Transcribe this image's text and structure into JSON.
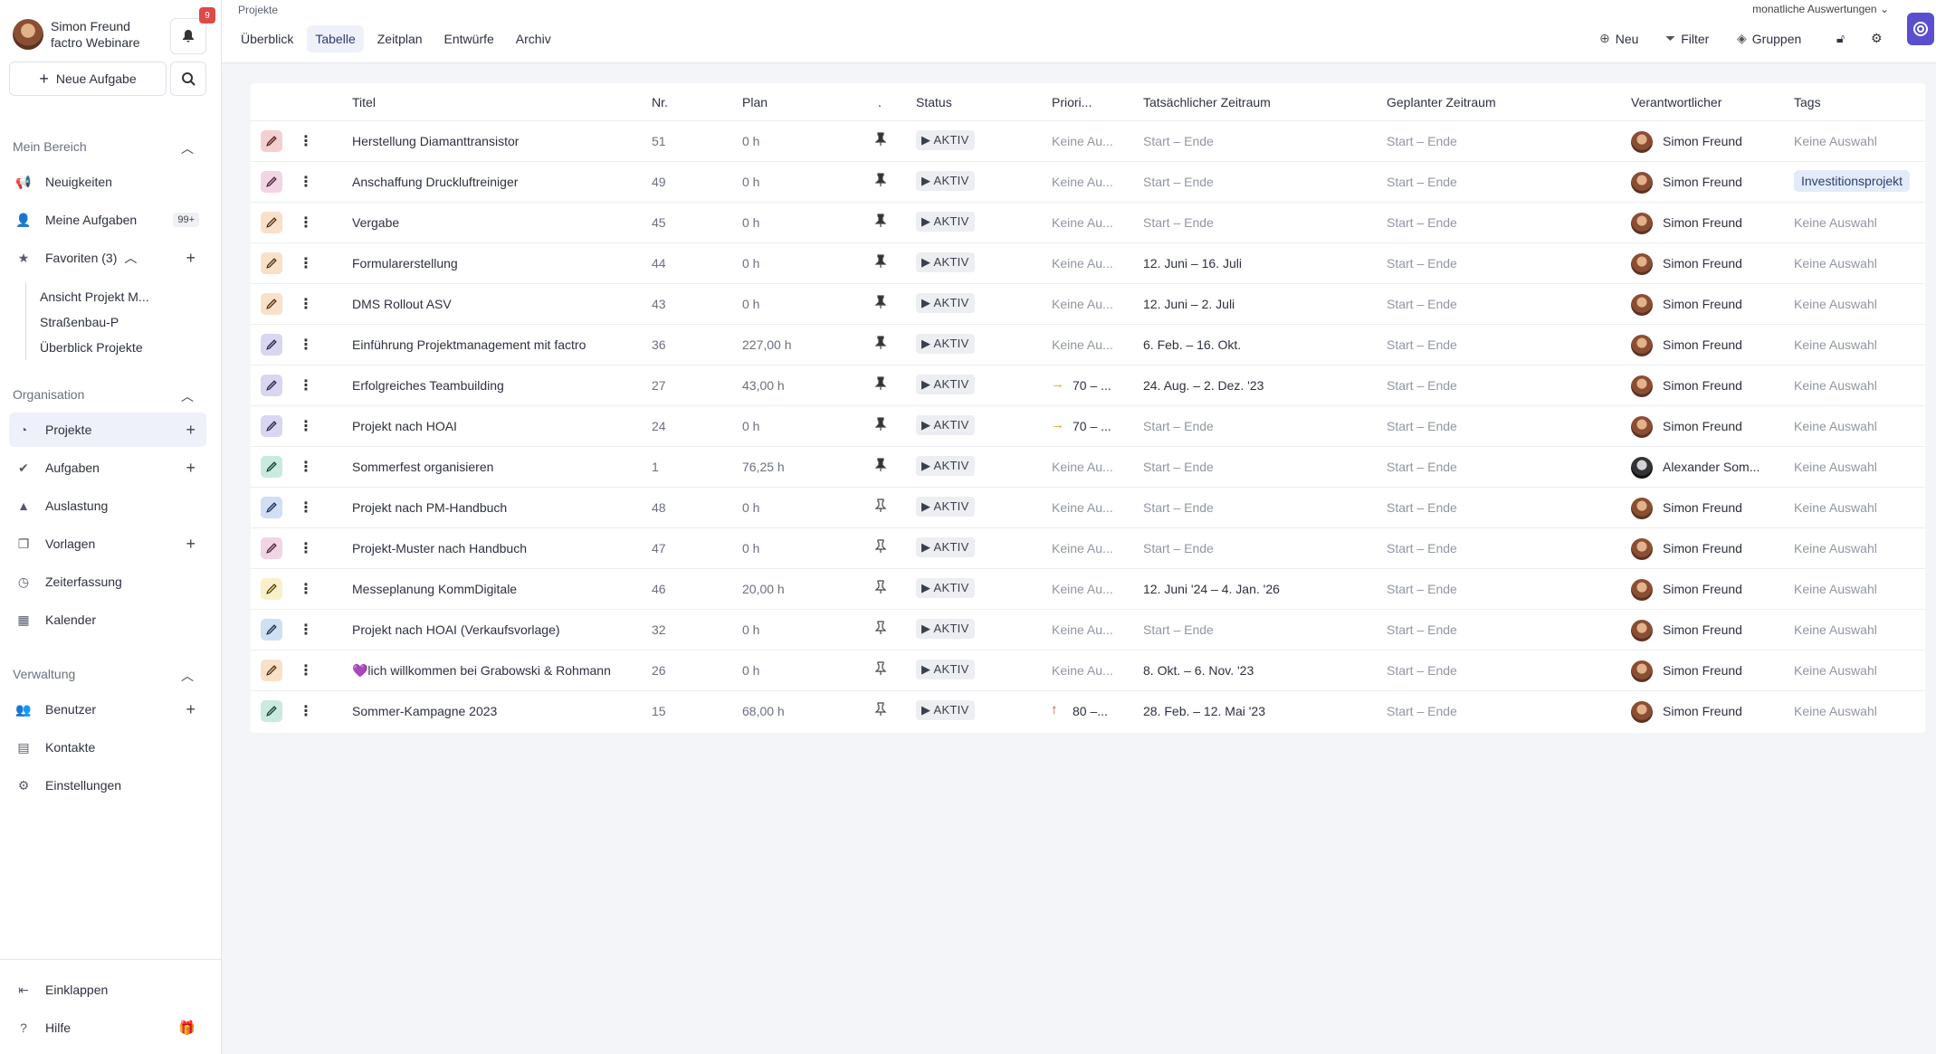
{
  "user": {
    "name": "Simon Freund",
    "org": "factro Webinare"
  },
  "notifications": {
    "count": "9"
  },
  "sidebar": {
    "new_task_label": "Neue Aufgabe",
    "sections": {
      "mein_bereich": "Mein Bereich",
      "organisation": "Organisation",
      "verwaltung": "Verwaltung"
    },
    "items": {
      "neuigkeiten": "Neuigkeiten",
      "meine_aufgaben": "Meine Aufgaben",
      "meine_aufgaben_badge": "99+",
      "favoriten": "Favoriten (3)",
      "projekte": "Projekte",
      "aufgaben": "Aufgaben",
      "auslastung": "Auslastung",
      "vorlagen": "Vorlagen",
      "zeiterfassung": "Zeiterfassung",
      "kalender": "Kalender",
      "benutzer": "Benutzer",
      "kontakte": "Kontakte",
      "einstellungen": "Einstellungen",
      "einklappen": "Einklappen",
      "hilfe": "Hilfe"
    },
    "favorites": [
      "Ansicht Projekt M...",
      "Straßenbau-P",
      "Überblick Projekte"
    ]
  },
  "header": {
    "breadcrumb": "Projekte",
    "tabs": [
      "Überblick",
      "Tabelle",
      "Zeitplan",
      "Entwürfe",
      "Archiv"
    ],
    "active_tab": "Tabelle",
    "report_label": "monatliche Auswertungen",
    "tools": {
      "neu": "Neu",
      "filter": "Filter",
      "gruppen": "Gruppen"
    }
  },
  "table": {
    "columns": {
      "titel": "Titel",
      "nr": "Nr.",
      "plan": "Plan",
      "pin": ".",
      "status": "Status",
      "prio": "Priori...",
      "tats": "Tatsächlicher Zeitraum",
      "gepl": "Geplanter Zeitraum",
      "verantw": "Verantwortlicher",
      "tags": "Tags"
    },
    "rows": [
      {
        "color": "#e2706f",
        "title": "Herstellung Diamanttransistor",
        "nr": "51",
        "plan": "0 h",
        "pinned": true,
        "status": "AKTIV",
        "prio": "Keine Au...",
        "prio_icon": "",
        "tats": "Start – Ende",
        "gepl": "Start – Ende",
        "owner": "Simon Freund",
        "tag": "Keine Auswahl",
        "tag_pill": false
      },
      {
        "color": "#d77fb0",
        "title": "Anschaffung Druckluftreiniger",
        "nr": "49",
        "plan": "0 h",
        "pinned": true,
        "status": "AKTIV",
        "prio": "Keine Au...",
        "prio_icon": "",
        "tats": "Start – Ende",
        "gepl": "Start – Ende",
        "owner": "Simon Freund",
        "tag": "Investitionsprojekt",
        "tag_pill": true
      },
      {
        "color": "#f0a35e",
        "title": "Vergabe",
        "nr": "45",
        "plan": "0 h",
        "pinned": true,
        "status": "AKTIV",
        "prio": "Keine Au...",
        "prio_icon": "",
        "tats": "Start – Ende",
        "gepl": "Start – Ende",
        "owner": "Simon Freund",
        "tag": "Keine Auswahl",
        "tag_pill": false
      },
      {
        "color": "#f0a35e",
        "title": "Formularerstellung",
        "nr": "44",
        "plan": "0 h",
        "pinned": true,
        "status": "AKTIV",
        "prio": "Keine Au...",
        "prio_icon": "",
        "tats": "12. Juni – 16. Juli",
        "gepl": "Start – Ende",
        "owner": "Simon Freund",
        "tag": "Keine Auswahl",
        "tag_pill": false
      },
      {
        "color": "#f0a35e",
        "title": "DMS Rollout ASV",
        "nr": "43",
        "plan": "0 h",
        "pinned": true,
        "status": "AKTIV",
        "prio": "Keine Au...",
        "prio_icon": "",
        "tats": "12. Juni – 2. Juli",
        "gepl": "Start – Ende",
        "owner": "Simon Freund",
        "tag": "Keine Auswahl",
        "tag_pill": false
      },
      {
        "color": "#8d84d9",
        "title": "Einführung Projektmanagement mit factro",
        "nr": "36",
        "plan": "227,00 h",
        "pinned": true,
        "status": "AKTIV",
        "prio": "Keine Au...",
        "prio_icon": "",
        "tats": "6. Feb. – 16. Okt.",
        "gepl": "Start – Ende",
        "owner": "Simon Freund",
        "tag": "Keine Auswahl",
        "tag_pill": false
      },
      {
        "color": "#8d84d9",
        "title": "Erfolgreiches Teambuilding",
        "nr": "27",
        "plan": "43,00 h",
        "pinned": true,
        "status": "AKTIV",
        "prio": "70 – ...",
        "prio_icon": "→",
        "tats": "24. Aug. – 2. Dez. '23",
        "gepl": "Start – Ende",
        "owner": "Simon Freund",
        "tag": "Keine Auswahl",
        "tag_pill": false
      },
      {
        "color": "#8d84d9",
        "title": "Projekt nach HOAI",
        "nr": "24",
        "plan": "0 h",
        "pinned": true,
        "status": "AKTIV",
        "prio": "70 – ...",
        "prio_icon": "→",
        "tats": "Start – Ende",
        "gepl": "Start – Ende",
        "owner": "Simon Freund",
        "tag": "Keine Auswahl",
        "tag_pill": false
      },
      {
        "color": "#5fc0a0",
        "title": "Sommerfest organisieren",
        "nr": "1",
        "plan": "76,25 h",
        "pinned": true,
        "status": "AKTIV",
        "prio": "Keine Au...",
        "prio_icon": "",
        "tats": "Start – Ende",
        "gepl": "Start – Ende",
        "owner": "Alexander Som...",
        "tag": "Keine Auswahl",
        "tag_pill": false
      },
      {
        "color": "#6f9ee0",
        "title": "Projekt nach PM-Handbuch",
        "nr": "48",
        "plan": "0 h",
        "pinned": false,
        "status": "AKTIV",
        "prio": "Keine Au...",
        "prio_icon": "",
        "tats": "Start – Ende",
        "gepl": "Start – Ende",
        "owner": "Simon Freund",
        "tag": "Keine Auswahl",
        "tag_pill": false
      },
      {
        "color": "#d77fb0",
        "title": "Projekt-Muster nach Handbuch",
        "nr": "47",
        "plan": "0 h",
        "pinned": false,
        "status": "AKTIV",
        "prio": "Keine Au...",
        "prio_icon": "",
        "tats": "Start – Ende",
        "gepl": "Start – Ende",
        "owner": "Simon Freund",
        "tag": "Keine Auswahl",
        "tag_pill": false
      },
      {
        "color": "#efd65a",
        "title": "Messeplanung KommDigitale",
        "nr": "46",
        "plan": "20,00 h",
        "pinned": false,
        "status": "AKTIV",
        "prio": "Keine Au...",
        "prio_icon": "",
        "tats": "12. Juni '24 – 4. Jan. '26",
        "gepl": "Start – Ende",
        "owner": "Simon Freund",
        "tag": "Keine Auswahl",
        "tag_pill": false
      },
      {
        "color": "#6f9ee0",
        "title": "Projekt nach HOAI (Verkaufsvorlage)",
        "nr": "32",
        "plan": "0 h",
        "pinned": false,
        "status": "AKTIV",
        "prio": "Keine Au...",
        "prio_icon": "",
        "tats": "Start – Ende",
        "gepl": "Start – Ende",
        "owner": "Simon Freund",
        "tag": "Keine Auswahl",
        "tag_pill": false
      },
      {
        "color": "#f0a35e",
        "title": "💜lich willkommen bei Grabowski & Rohmann",
        "nr": "26",
        "plan": "0 h",
        "pinned": false,
        "status": "AKTIV",
        "prio": "Keine Au...",
        "prio_icon": "",
        "tats": "8. Okt. – 6. Nov. '23",
        "gepl": "Start – Ende",
        "owner": "Simon Freund",
        "tag": "Keine Auswahl",
        "tag_pill": false
      },
      {
        "color": "#5fc0a0",
        "title": "Sommer-Kampagne 2023",
        "nr": "15",
        "plan": "68,00 h",
        "pinned": false,
        "status": "AKTIV",
        "prio": "80 –...",
        "prio_icon": "↑",
        "tats": "28. Feb. – 12. Mai '23",
        "gepl": "Start – Ende",
        "owner": "Simon Freund",
        "tag": "Keine Auswahl",
        "tag_pill": false
      }
    ]
  }
}
